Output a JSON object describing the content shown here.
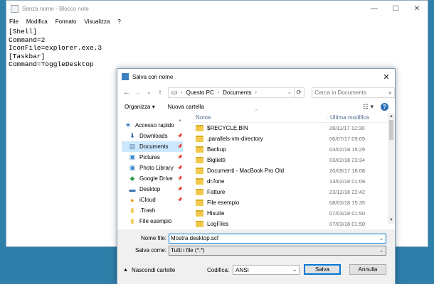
{
  "notepad": {
    "title": "Senza nome - Blocco note",
    "menu": [
      "File",
      "Modifica",
      "Formato",
      "Visualizza",
      "?"
    ],
    "content": "[Shell]\nCommand=2\nIconFile=explorer.exe,3\n[Taskbar]\nCommand=ToggleDesktop"
  },
  "dialog": {
    "title": "Salva con nome",
    "address": {
      "segments": [
        "Questo PC",
        "Documents"
      ]
    },
    "search_placeholder": "Cerca in Documents",
    "toolbar": {
      "organize": "Organizza",
      "new_folder": "Nuova cartella"
    },
    "nav_items": [
      {
        "label": "Accesso rapido",
        "icon": "star-icon",
        "pinned": false,
        "selected": false
      },
      {
        "label": "Downloads",
        "icon": "download-icon",
        "pinned": true,
        "selected": false
      },
      {
        "label": "Documents",
        "icon": "document-icon",
        "pinned": true,
        "selected": true
      },
      {
        "label": "Pictures",
        "icon": "picture-icon",
        "pinned": true,
        "selected": false
      },
      {
        "label": "Photo Library",
        "icon": "photo-icon",
        "pinned": true,
        "selected": false
      },
      {
        "label": "Google Drive",
        "icon": "drive-icon",
        "pinned": true,
        "selected": false
      },
      {
        "label": "Desktop",
        "icon": "desktop-icon",
        "pinned": true,
        "selected": false
      },
      {
        "label": "iCloud",
        "icon": "cloud-icon",
        "pinned": true,
        "selected": false
      },
      {
        "label": ".Trash",
        "icon": "folder-icon",
        "pinned": false,
        "selected": false
      },
      {
        "label": "File esempio",
        "icon": "folder-icon",
        "pinned": false,
        "selected": false
      }
    ],
    "columns": {
      "name": "Nome",
      "date": "Ultima modifica"
    },
    "files": [
      {
        "name": "$RECYCLE.BIN",
        "date": "28/11/17 12:30"
      },
      {
        "name": ".parallels-vm-directory",
        "date": "06/07/17 09:09"
      },
      {
        "name": "Backup",
        "date": "03/02/18 15:29"
      },
      {
        "name": "Biglietti",
        "date": "03/02/18 23:34"
      },
      {
        "name": "Documenti - MacBook Pro Old",
        "date": "20/09/17 18:08"
      },
      {
        "name": "dr.fone",
        "date": "13/02/18 01:09"
      },
      {
        "name": "Fatture",
        "date": "23/12/18 22:42"
      },
      {
        "name": "File esempio",
        "date": "08/03/18 15:35"
      },
      {
        "name": "Hisuite",
        "date": "07/03/18 01:50"
      },
      {
        "name": "LogFiles",
        "date": "07/03/18 01:50"
      }
    ],
    "filename_label": "Nome file:",
    "filename_value": "Mostra desktop.scf",
    "savetype_label": "Salva come:",
    "savetype_value": "Tutti i file  (*.*)",
    "hide_folders": "Nascondi cartelle",
    "encoding_label": "Codifica:",
    "encoding_value": "ANSI",
    "save_button": "Salva",
    "cancel_button": "Annulla"
  }
}
